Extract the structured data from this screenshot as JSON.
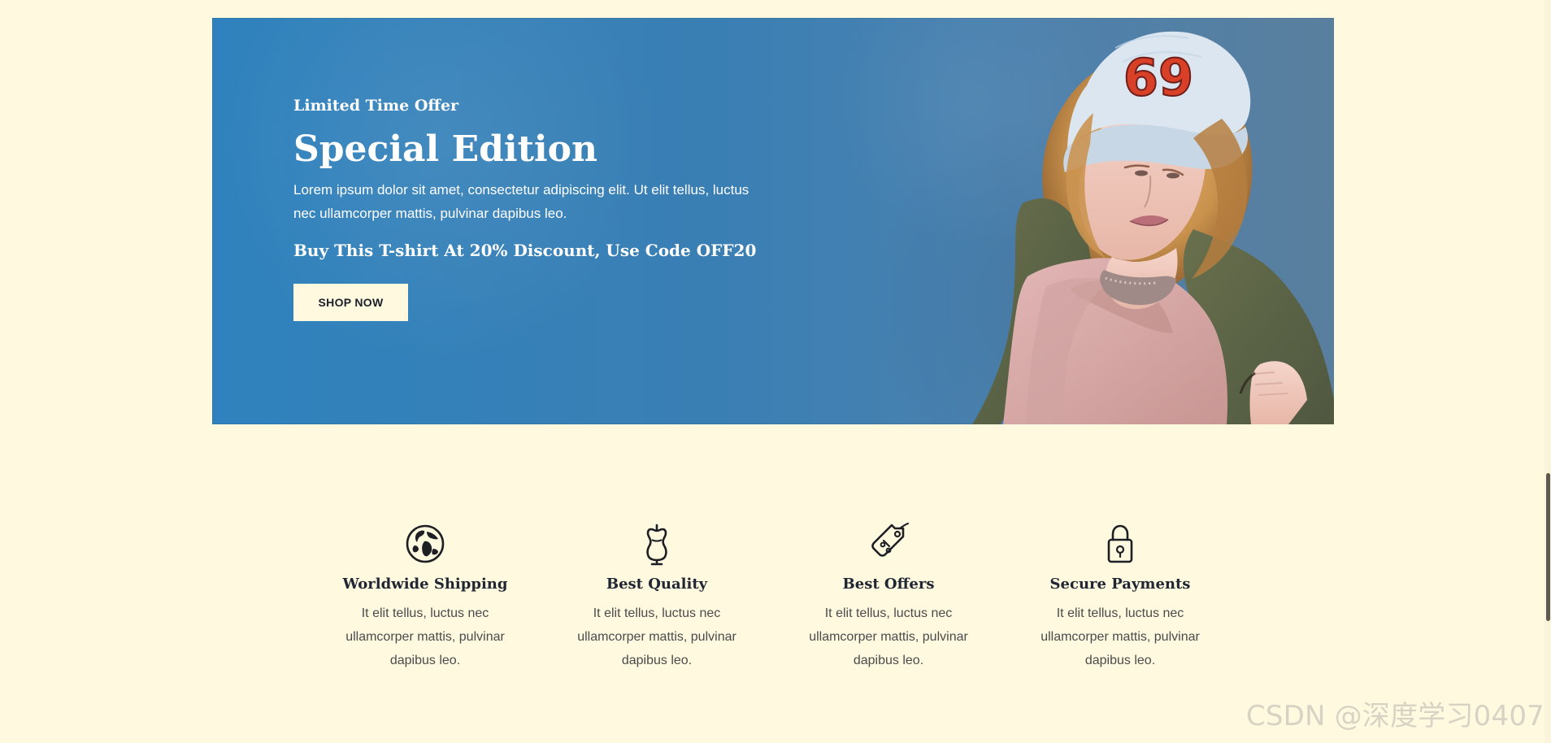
{
  "hero": {
    "eyebrow": "Limited Time Offer",
    "title": "Special Edition",
    "description": "Lorem ipsum dolor sit amet, consectetur adipiscing elit. Ut elit tellus, luctus nec ullamcorper mattis, pulvinar dapibus leo.",
    "offer": "Buy This T-shirt At 20% Discount, Use Code OFF20",
    "button_label": "SHOP NOW",
    "cap_number": "69",
    "background_start": "#2f82bd",
    "background_end": "#577f9f"
  },
  "features": [
    {
      "icon": "globe-icon",
      "title": "Worldwide Shipping",
      "text": "It elit tellus, luctus nec ullamcorper mattis, pulvinar dapibus leo."
    },
    {
      "icon": "mannequin-icon",
      "title": "Best Quality",
      "text": "It elit tellus, luctus nec ullamcorper mattis, pulvinar dapibus leo."
    },
    {
      "icon": "tag-icon",
      "title": "Best Offers",
      "text": "It elit tellus, luctus nec ullamcorper mattis, pulvinar dapibus leo."
    },
    {
      "icon": "lock-icon",
      "title": "Secure Payments",
      "text": "It elit tellus, luctus nec ullamcorper mattis, pulvinar dapibus leo."
    }
  ],
  "watermark": "CSDN @深度学习0407",
  "colors": {
    "page_background": "#fff9e0",
    "button_background": "#fff9e0",
    "text_dark": "#202632"
  }
}
